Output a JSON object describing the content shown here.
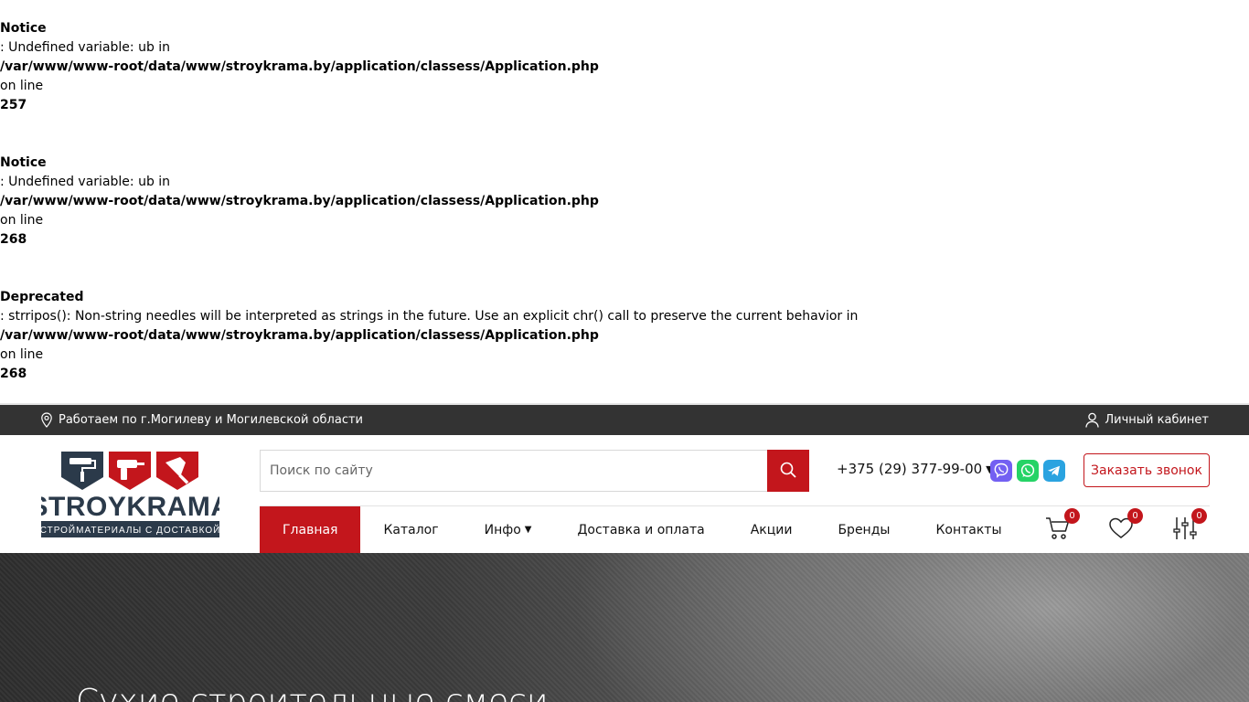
{
  "errors": [
    {
      "type": "Notice",
      "message": ": Undefined variable: ub in",
      "file": "/var/www/www-root/data/www/stroykrama.by/application/classess/Application.php",
      "on_line": "on line",
      "line": "257"
    },
    {
      "type": "Notice",
      "message": ": Undefined variable: ub in",
      "file": "/var/www/www-root/data/www/stroykrama.by/application/classess/Application.php",
      "on_line": "on line",
      "line": "268"
    },
    {
      "type": "Deprecated",
      "message": ": strripos(): Non-string needles will be interpreted as strings in the future. Use an explicit chr() call to preserve the current behavior in",
      "file": "/var/www/www-root/data/www/stroykrama.by/application/classess/Application.php",
      "on_line": "on line",
      "line": "268"
    }
  ],
  "topbar": {
    "location_text": "Работаем по г.Могилеву и Могилевской области",
    "account_text": "Личный кабинет"
  },
  "logo": {
    "brand": "STROYKRAMA",
    "tagline": "СТРОЙМАТЕРИАЛЫ С ДОСТАВКОЙ",
    "colors": {
      "navy": "#2b3a4a",
      "red": "#c3161c"
    }
  },
  "search": {
    "placeholder": "Поиск по сайту",
    "value": ""
  },
  "phone": "+375 (29) 377-99-00",
  "messengers": [
    "viber-icon",
    "whatsapp-icon",
    "telegram-icon"
  ],
  "callback_label": "Заказать звонок",
  "nav": [
    {
      "label": "Главная",
      "active": true
    },
    {
      "label": "Каталог"
    },
    {
      "label": "Инфо",
      "dropdown": true
    },
    {
      "label": "Доставка и оплата"
    },
    {
      "label": "Акции"
    },
    {
      "label": "Бренды"
    },
    {
      "label": "Контакты"
    }
  ],
  "tools": {
    "cart_count": "0",
    "favorites_count": "0",
    "compare_count": "0"
  },
  "hero": {
    "title": "Сухие строительные смеси"
  },
  "colors": {
    "accent": "#c3161c",
    "topbar_bg": "#333333"
  }
}
